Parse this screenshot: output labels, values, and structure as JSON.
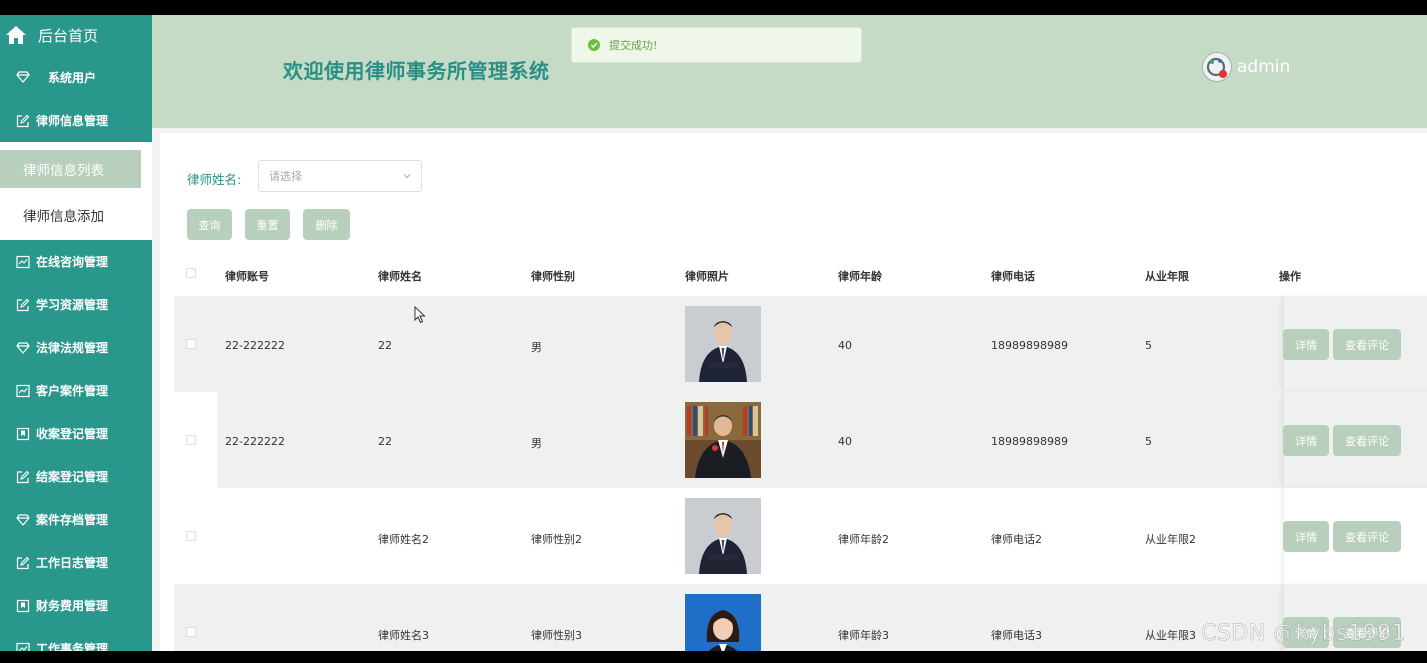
{
  "sidebar": {
    "home_label": "后台首页",
    "items": [
      {
        "label": "系统用户",
        "icon": "diamond-icon"
      },
      {
        "label": "律师信息管理",
        "icon": "edit-icon"
      },
      {
        "label": "在线咨询管理",
        "icon": "chart-icon"
      },
      {
        "label": "学习资源管理",
        "icon": "edit-icon"
      },
      {
        "label": "法律法规管理",
        "icon": "diamond-icon"
      },
      {
        "label": "客户案件管理",
        "icon": "chart-icon"
      },
      {
        "label": "收案登记管理",
        "icon": "bookmark-icon"
      },
      {
        "label": "结案登记管理",
        "icon": "edit-icon"
      },
      {
        "label": "案件存档管理",
        "icon": "diamond-icon"
      },
      {
        "label": "工作日志管理",
        "icon": "edit-icon"
      },
      {
        "label": "财务费用管理",
        "icon": "bookmark-icon"
      },
      {
        "label": "工作事务管理",
        "icon": "chart-icon"
      }
    ],
    "subitems": [
      {
        "label": "律师信息列表",
        "active": true
      },
      {
        "label": "律师信息添加",
        "active": false
      }
    ]
  },
  "header": {
    "title": "欢迎使用律师事务所管理系统",
    "user": "admin",
    "toast": "提交成功!"
  },
  "search": {
    "label": "律师姓名:",
    "placeholder": "请选择"
  },
  "buttons": {
    "query": "查询",
    "reset": "重置",
    "delete": "删除"
  },
  "table": {
    "columns": [
      "律师账号",
      "律师姓名",
      "律师性别",
      "律师照片",
      "律师年龄",
      "律师电话",
      "从业年限",
      "操作"
    ],
    "rows": [
      {
        "account": "22-222222",
        "name": "22",
        "gender": "男",
        "age": "40",
        "phone": "18989898989",
        "years": "5"
      },
      {
        "account": "22-222222",
        "name": "22",
        "gender": "男",
        "age": "40",
        "phone": "18989898989",
        "years": "5"
      },
      {
        "account": "",
        "name": "律师姓名2",
        "gender": "律师性别2",
        "age": "律师年龄2",
        "phone": "律师电话2",
        "years": "从业年限2"
      },
      {
        "account": "",
        "name": "律师姓名3",
        "gender": "律师性别3",
        "age": "律师年龄3",
        "phone": "律师电话3",
        "years": "从业年限3"
      }
    ],
    "actions": {
      "detail": "详情",
      "comments": "查看评论"
    }
  },
  "watermark": "CSDN @kybs1991",
  "colors": {
    "sidebar": "#2a978c",
    "header": "#c5dbc5",
    "accent": "#2a8f86",
    "button": "#b8cfbd",
    "toast_text": "#67a046"
  }
}
